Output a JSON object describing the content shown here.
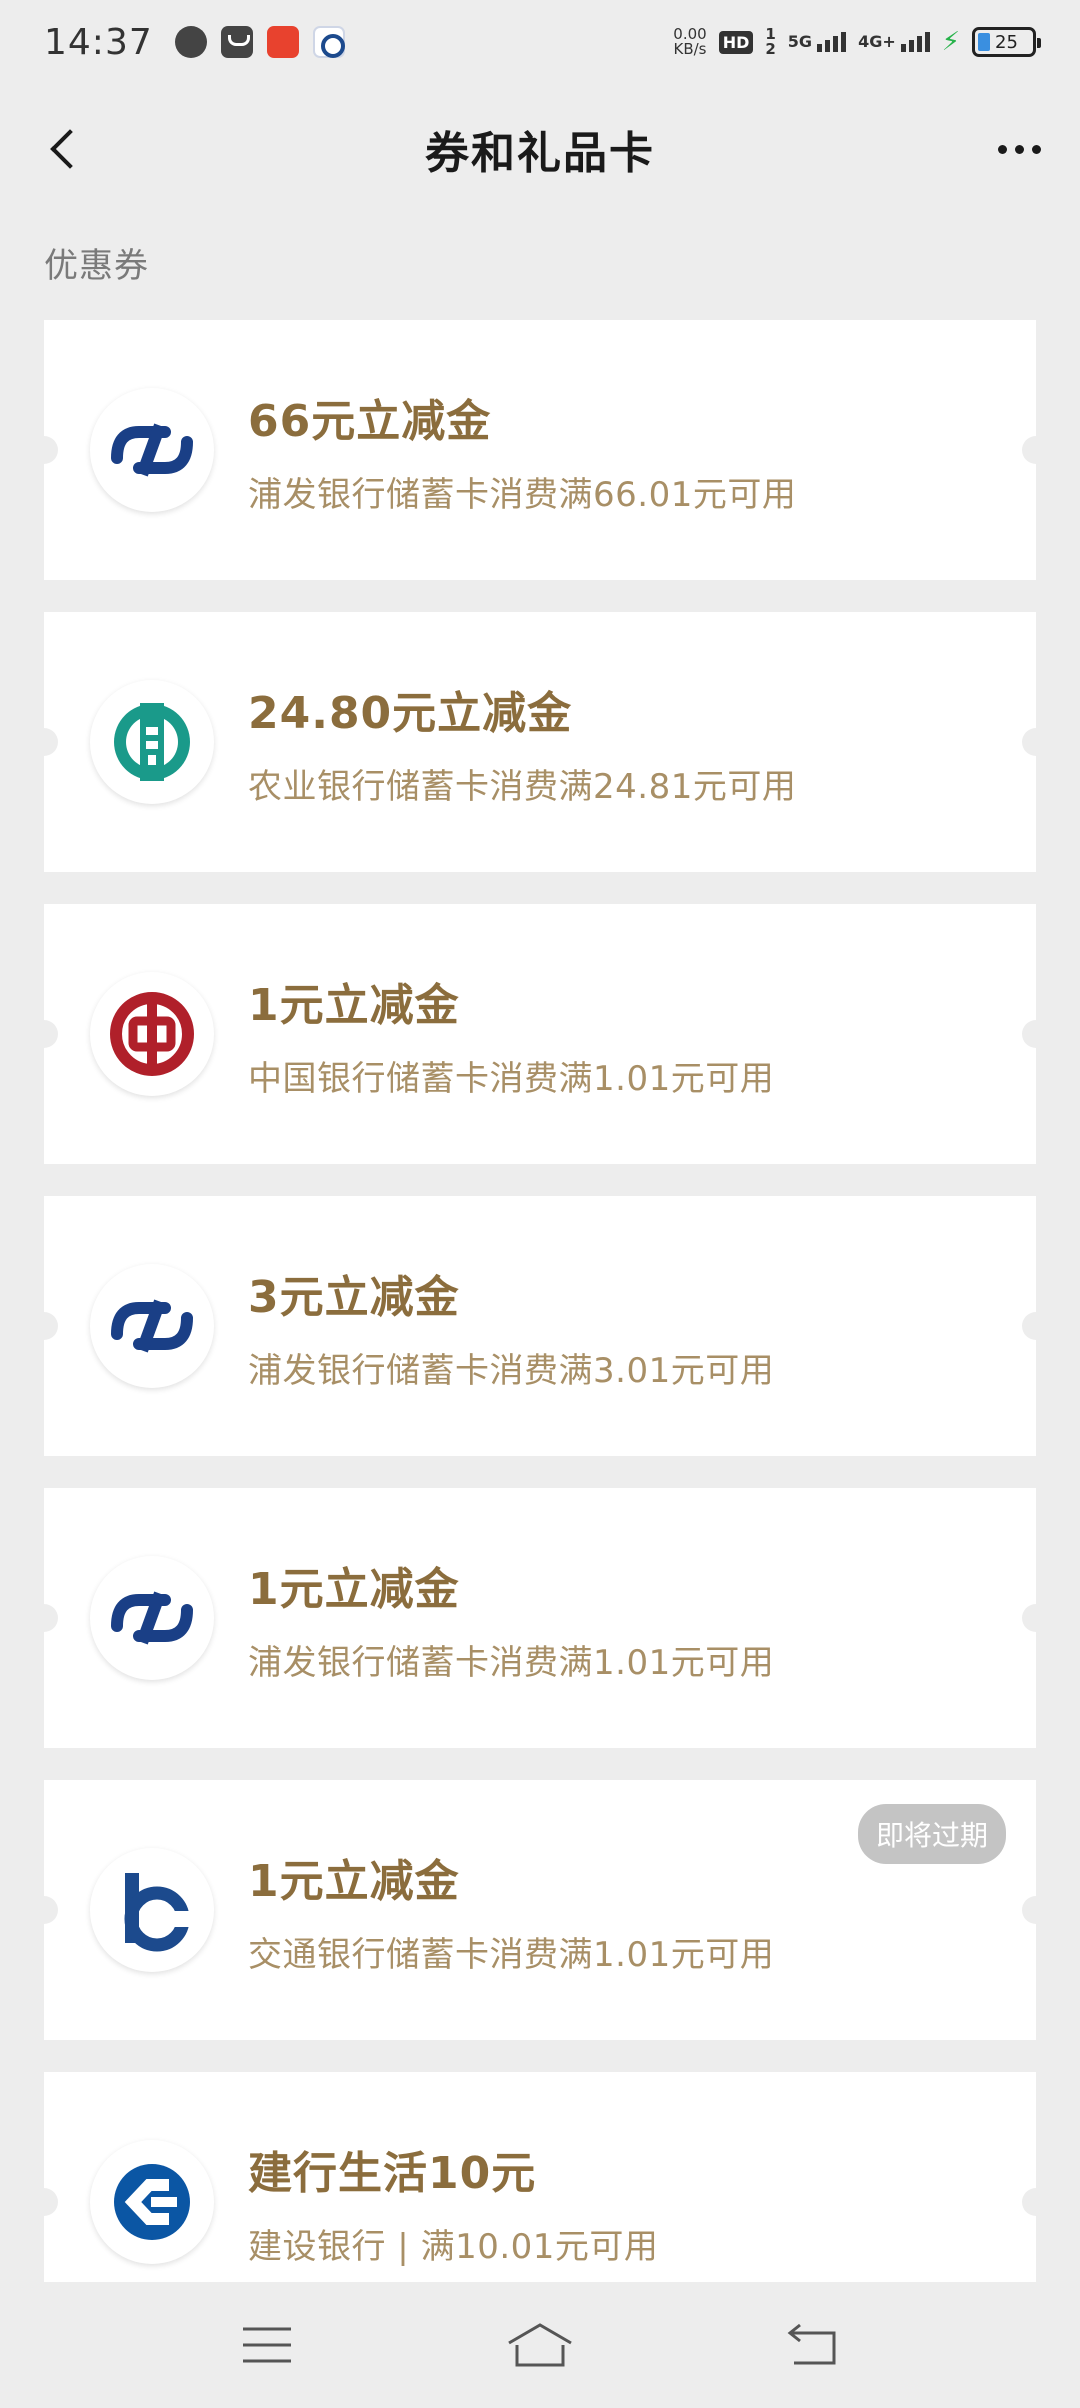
{
  "status_bar": {
    "time": "14:37",
    "net_speed_value": "0.00",
    "net_speed_unit": "KB/s",
    "hd": "HD",
    "sim1": "1",
    "sim2": "2",
    "signal1_label": "5G",
    "signal2_label": "4G+",
    "battery": "25"
  },
  "header": {
    "title": "券和礼品卡"
  },
  "section": {
    "label": "优惠券"
  },
  "coupons": [
    {
      "title": "66元立减金",
      "desc": "浦发银行储蓄卡消费满66.01元可用",
      "bank_icon": "spdb-logo-icon"
    },
    {
      "title": "24.80元立减金",
      "desc": "农业银行储蓄卡消费满24.81元可用",
      "bank_icon": "abc-logo-icon"
    },
    {
      "title": "1元立减金",
      "desc": "中国银行储蓄卡消费满1.01元可用",
      "bank_icon": "boc-logo-icon"
    },
    {
      "title": "3元立减金",
      "desc": "浦发银行储蓄卡消费满3.01元可用",
      "bank_icon": "spdb-logo-icon"
    },
    {
      "title": "1元立减金",
      "desc": "浦发银行储蓄卡消费满1.01元可用",
      "bank_icon": "spdb-logo-icon"
    },
    {
      "title": "1元立减金",
      "desc": "交通银行储蓄卡消费满1.01元可用",
      "bank_icon": "bocom-logo-icon",
      "badge": "即将过期"
    },
    {
      "title": "建行生活10元",
      "desc": "建设银行 | 满10.01元可用",
      "bank_icon": "ccb-logo-icon"
    }
  ],
  "colors": {
    "title_gold": "#8b6d3d",
    "desc_gold": "#a88f66",
    "spdb_blue": "#1a3f86",
    "abc_green": "#1a9a8a",
    "boc_red": "#b0202a",
    "bocom_blue": "#1c4a8d",
    "ccb_blue": "#0b56a4"
  }
}
